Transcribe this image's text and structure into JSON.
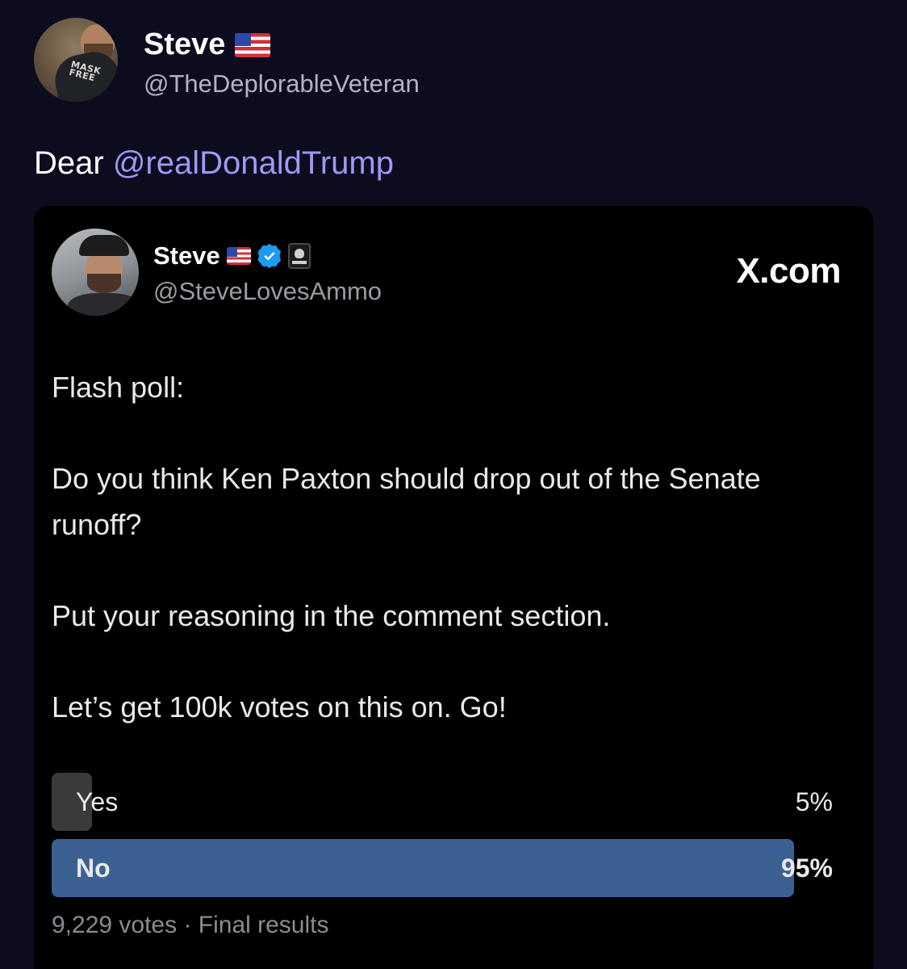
{
  "post": {
    "author_name": "Steve",
    "author_handle": "@TheDeplorableVeteran",
    "author_flag_icon": "us-flag-icon",
    "avatar_shirt_text": "MASK FREE",
    "text_prefix": "Dear ",
    "mention": "@realDonaldTrump",
    "mention_color": "#9f98f5"
  },
  "embedded": {
    "author_name": "Steve",
    "author_handle": "@SteveLovesAmmo",
    "author_flag_icon": "us-flag-icon",
    "verified_icon": "verified-badge-icon",
    "affiliate_icon": "affiliate-badge-icon",
    "source": "X.com",
    "paragraphs": [
      "Flash poll:",
      "Do you think Ken Paxton should drop out of the Senate runoff?",
      "Put your reasoning in the comment section.",
      "Let’s get 100k votes on this on. Go!"
    ],
    "poll": {
      "options": [
        {
          "label": "Yes",
          "percent_text": "5%",
          "fraction": 0.05,
          "winner": false
        },
        {
          "label": "No",
          "percent_text": "95%",
          "fraction": 0.95,
          "winner": true
        }
      ],
      "meta": "9,229 votes · Final results",
      "winner_color": "#3b6192"
    }
  }
}
